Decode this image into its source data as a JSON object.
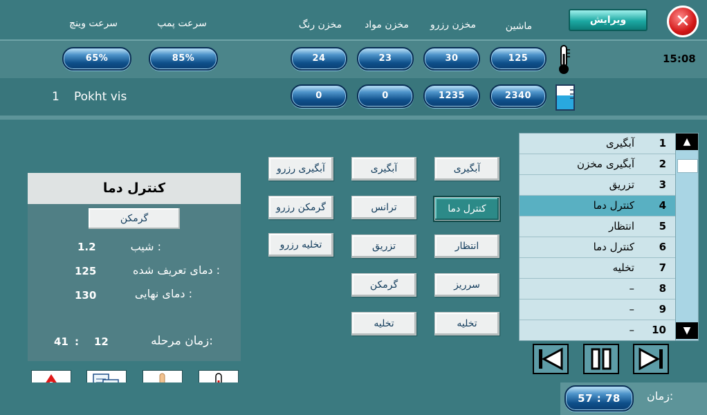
{
  "header": {
    "edit_label": "ویرایش",
    "close_icon": "close-icon",
    "columns": [
      "ماشین",
      "مخزن رزرو",
      "مخزن مواد",
      "مخزن رنگ"
    ],
    "speed_headers": [
      "سرعت پمپ",
      "سرعت وینچ"
    ]
  },
  "clock": "15:08",
  "temperatures": [
    "125",
    "30",
    "23",
    "24"
  ],
  "speeds": [
    "85%",
    "65%"
  ],
  "volumes": [
    "2340",
    "1235",
    "0",
    "0"
  ],
  "recipe": {
    "number": "1",
    "name": "Pokht vis"
  },
  "buttons": {
    "col1": [
      "آبگیری",
      "کنترل دما",
      "انتظار",
      "سرریز",
      "تخلیه"
    ],
    "col2": [
      "آبگیری",
      "ترانس",
      "تزریق",
      "گرمکن",
      "تخلیه"
    ],
    "col3": [
      "آبگیری رزرو",
      "گرمکن رزرو",
      "تخلیه رزرو"
    ]
  },
  "panel": {
    "title": "کنترل دما",
    "sub_button": "گرمکن",
    "slope_label": "شیب :",
    "slope_value": "1.2",
    "setpoint_label": "دمای تعریف شده :",
    "setpoint_value": "125",
    "final_label": "دمای نهایی :",
    "final_value": "130",
    "stage_time_label": "زمان مرحله:",
    "stage_minutes": "12",
    "stage_seconds": "41",
    "sep": ":"
  },
  "steps": [
    {
      "n": "1",
      "label": "آبگیری"
    },
    {
      "n": "2",
      "label": "آبگیری مخزن"
    },
    {
      "n": "3",
      "label": "تزریق"
    },
    {
      "n": "4",
      "label": "کنترل دما"
    },
    {
      "n": "5",
      "label": "انتظار"
    },
    {
      "n": "6",
      "label": "کنترل دما"
    },
    {
      "n": "7",
      "label": "تخلیه"
    },
    {
      "n": "8",
      "label": "–"
    },
    {
      "n": "9",
      "label": "–"
    },
    {
      "n": "10",
      "label": "–"
    }
  ],
  "selected_step": "4",
  "footer": {
    "time_label": "زمان:",
    "time_value": "57 : 78"
  }
}
